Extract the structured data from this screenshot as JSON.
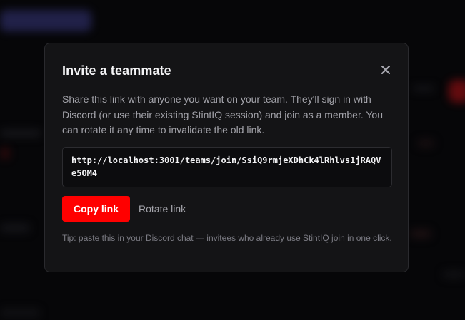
{
  "modal": {
    "title": "Invite a teammate",
    "close_icon": "close-icon",
    "description": "Share this link with anyone you want on your team. They'll sign in with Discord (or use their existing StintIQ session) and join as a member. You can rotate it any time to invalidate the old link.",
    "invite_link": "http://localhost:3001/teams/join/SsiQ9rmjeXDhCk4lRhlvs1jRAQVe5OM4",
    "copy_label": "Copy link",
    "rotate_label": "Rotate link",
    "tip": "Tip: paste this in your Discord chat — invitees who already use StintIQ join in one click."
  },
  "colors": {
    "accent": "#ff0000",
    "modal_bg": "#141416",
    "backdrop": "#060608",
    "text_primary": "#f4f4f6",
    "text_secondary": "#a3a3aa",
    "text_muted": "#7c7c84"
  }
}
